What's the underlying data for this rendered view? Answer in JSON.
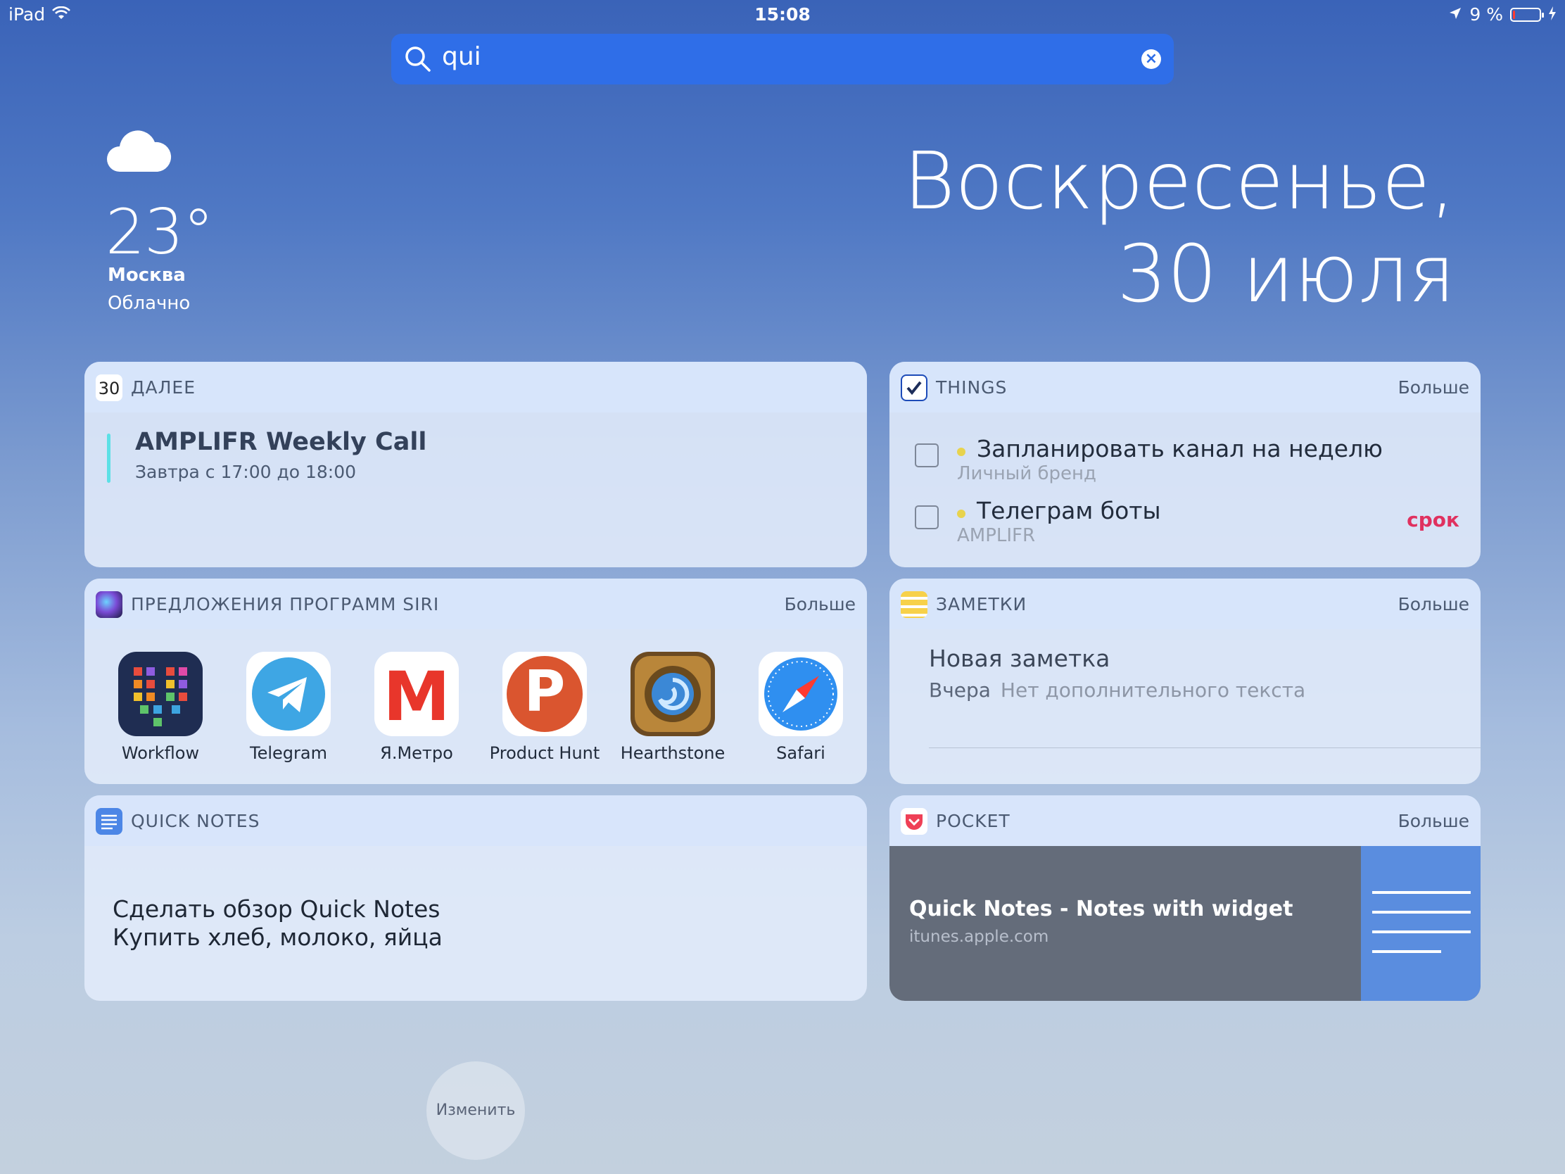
{
  "status_bar": {
    "device": "iPad",
    "time": "15:08",
    "battery": "9 %",
    "battery_level": 0.09
  },
  "search": {
    "value": "qui"
  },
  "weather": {
    "temperature": "23°",
    "city": "Москва",
    "condition": "Облачно",
    "icon": "cloud-icon"
  },
  "date": {
    "line1": "Воскресенье,",
    "line2": "30 июля"
  },
  "widgets": {
    "next": {
      "icon_text": "30",
      "title": "ДАЛЕЕ",
      "event_title": "AMPLIFR Weekly Call",
      "event_time": "Завтра с 17:00 до 18:00"
    },
    "things": {
      "title": "THINGS",
      "more": "Больше",
      "tasks": [
        {
          "name": "Запланировать канал на неделю",
          "project": "Личный бренд",
          "due": ""
        },
        {
          "name": "Телеграм боты",
          "project": "AMPLIFR",
          "due": "срок"
        }
      ]
    },
    "siri": {
      "title": "ПРЕДЛОЖЕНИЯ ПРОГРАММ SIRI",
      "more": "Больше",
      "apps": [
        {
          "label": "Workflow"
        },
        {
          "label": "Telegram"
        },
        {
          "label": "Я.Метро",
          "glyph": "М"
        },
        {
          "label": "Product Hunt",
          "glyph": "P"
        },
        {
          "label": "Hearthstone"
        },
        {
          "label": "Safari"
        }
      ]
    },
    "notes": {
      "title": "ЗАМЕТКИ",
      "more": "Больше",
      "note_title": "Новая заметка",
      "note_date": "Вчера",
      "note_text": "Нет дополнительного текста"
    },
    "quick_notes": {
      "title": "QUICK NOTES",
      "line1": "Сделать обзор Quick Notes",
      "line2": "Купить хлеб, молоко, яйца"
    },
    "pocket": {
      "title": "POCKET",
      "more": "Больше",
      "item_title": "Quick Notes - Notes with widget",
      "item_domain": "itunes.apple.com"
    }
  },
  "edit_button": "Изменить",
  "colors": {
    "search_bg": "#2f6ee8",
    "due": "#e0315f",
    "project_dot": "#e8d34d",
    "event_bar": "#5ce0e6"
  }
}
